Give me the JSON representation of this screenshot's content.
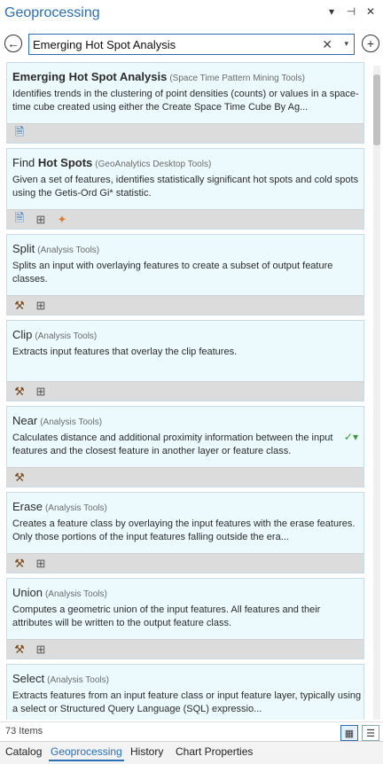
{
  "pane": {
    "title": "Geoprocessing",
    "controls": [
      "▾",
      "⊣",
      "✕"
    ]
  },
  "search": {
    "value": "Emerging Hot Spot Analysis",
    "clear_glyph": "✕",
    "dropdown_glyph": "▾"
  },
  "results": [
    {
      "name_bold": "Emerging Hot Spot Analysis",
      "name_pre": "",
      "toolbox": "(Space Time Pattern Mining Tools)",
      "description": "Identifies trends in the clustering of point densities (counts) or values in a space-time cube created using either the Create Space Time Cube By Ag...",
      "icons": [
        "script-icon"
      ]
    },
    {
      "name_pre": "Find ",
      "name_bold": "Hot Spots",
      "toolbox": "(GeoAnalytics Desktop Tools)",
      "description": "Given a set of features, identifies statistically significant hot spots and cold spots using the Getis-Ord Gi* statistic.",
      "icons": [
        "script-icon",
        "model-icon",
        "spark-icon"
      ]
    },
    {
      "name_pre": "",
      "name_bold": "",
      "name_plain": "Split",
      "toolbox": "(Analysis Tools)",
      "description": "Splits an input with overlaying features to  create a subset of output feature classes.",
      "icons": [
        "hammer-icon",
        "model-icon"
      ]
    },
    {
      "name_plain": "Clip",
      "toolbox": "(Analysis Tools)",
      "description": "Extracts input features that overlay the clip features.",
      "icons": [
        "hammer-icon",
        "model-icon"
      ]
    },
    {
      "name_plain": "Near",
      "toolbox": "(Analysis Tools)",
      "description": "Calculates distance and additional proximity information between the input features and the closest feature in another layer or feature class.",
      "icons": [
        "hammer-icon"
      ]
    },
    {
      "name_plain": "Erase",
      "toolbox": "(Analysis Tools)",
      "description": "Creates a feature class by overlaying the input features with the erase features. Only those portions of the input features falling outside the era...",
      "icons": [
        "hammer-icon",
        "model-icon"
      ]
    },
    {
      "name_plain": "Union",
      "toolbox": "(Analysis Tools)",
      "description": "Computes a geometric union of the input features. All features and their attributes will be written to the output feature class.",
      "icons": [
        "hammer-icon",
        "model-icon"
      ]
    },
    {
      "name_plain": "Select",
      "toolbox": "(Analysis Tools)",
      "description": "Extracts features from an input feature class or input feature layer, typically using a select or Structured Query Language (SQL) expressio...",
      "icons": []
    }
  ],
  "status": {
    "count": "73 Items"
  },
  "tabs": [
    "Catalog",
    "Geoprocessing",
    "History",
    "Chart Properties"
  ],
  "active_tab": "Geoprocessing",
  "colors": {
    "accent": "#2a6fb6",
    "card_bg": "#ecfafe",
    "card_bar": "#dcdcdc"
  }
}
